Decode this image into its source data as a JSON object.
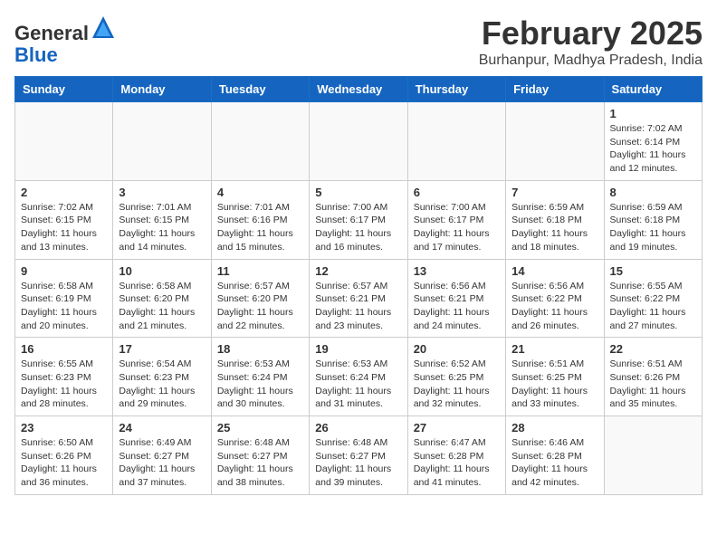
{
  "logo": {
    "general": "General",
    "blue": "Blue"
  },
  "title": {
    "month": "February 2025",
    "location": "Burhanpur, Madhya Pradesh, India"
  },
  "weekdays": [
    "Sunday",
    "Monday",
    "Tuesday",
    "Wednesday",
    "Thursday",
    "Friday",
    "Saturday"
  ],
  "weeks": [
    [
      {
        "day": "",
        "info": ""
      },
      {
        "day": "",
        "info": ""
      },
      {
        "day": "",
        "info": ""
      },
      {
        "day": "",
        "info": ""
      },
      {
        "day": "",
        "info": ""
      },
      {
        "day": "",
        "info": ""
      },
      {
        "day": "1",
        "info": "Sunrise: 7:02 AM\nSunset: 6:14 PM\nDaylight: 11 hours\nand 12 minutes."
      }
    ],
    [
      {
        "day": "2",
        "info": "Sunrise: 7:02 AM\nSunset: 6:15 PM\nDaylight: 11 hours\nand 13 minutes."
      },
      {
        "day": "3",
        "info": "Sunrise: 7:01 AM\nSunset: 6:15 PM\nDaylight: 11 hours\nand 14 minutes."
      },
      {
        "day": "4",
        "info": "Sunrise: 7:01 AM\nSunset: 6:16 PM\nDaylight: 11 hours\nand 15 minutes."
      },
      {
        "day": "5",
        "info": "Sunrise: 7:00 AM\nSunset: 6:17 PM\nDaylight: 11 hours\nand 16 minutes."
      },
      {
        "day": "6",
        "info": "Sunrise: 7:00 AM\nSunset: 6:17 PM\nDaylight: 11 hours\nand 17 minutes."
      },
      {
        "day": "7",
        "info": "Sunrise: 6:59 AM\nSunset: 6:18 PM\nDaylight: 11 hours\nand 18 minutes."
      },
      {
        "day": "8",
        "info": "Sunrise: 6:59 AM\nSunset: 6:18 PM\nDaylight: 11 hours\nand 19 minutes."
      }
    ],
    [
      {
        "day": "9",
        "info": "Sunrise: 6:58 AM\nSunset: 6:19 PM\nDaylight: 11 hours\nand 20 minutes."
      },
      {
        "day": "10",
        "info": "Sunrise: 6:58 AM\nSunset: 6:20 PM\nDaylight: 11 hours\nand 21 minutes."
      },
      {
        "day": "11",
        "info": "Sunrise: 6:57 AM\nSunset: 6:20 PM\nDaylight: 11 hours\nand 22 minutes."
      },
      {
        "day": "12",
        "info": "Sunrise: 6:57 AM\nSunset: 6:21 PM\nDaylight: 11 hours\nand 23 minutes."
      },
      {
        "day": "13",
        "info": "Sunrise: 6:56 AM\nSunset: 6:21 PM\nDaylight: 11 hours\nand 24 minutes."
      },
      {
        "day": "14",
        "info": "Sunrise: 6:56 AM\nSunset: 6:22 PM\nDaylight: 11 hours\nand 26 minutes."
      },
      {
        "day": "15",
        "info": "Sunrise: 6:55 AM\nSunset: 6:22 PM\nDaylight: 11 hours\nand 27 minutes."
      }
    ],
    [
      {
        "day": "16",
        "info": "Sunrise: 6:55 AM\nSunset: 6:23 PM\nDaylight: 11 hours\nand 28 minutes."
      },
      {
        "day": "17",
        "info": "Sunrise: 6:54 AM\nSunset: 6:23 PM\nDaylight: 11 hours\nand 29 minutes."
      },
      {
        "day": "18",
        "info": "Sunrise: 6:53 AM\nSunset: 6:24 PM\nDaylight: 11 hours\nand 30 minutes."
      },
      {
        "day": "19",
        "info": "Sunrise: 6:53 AM\nSunset: 6:24 PM\nDaylight: 11 hours\nand 31 minutes."
      },
      {
        "day": "20",
        "info": "Sunrise: 6:52 AM\nSunset: 6:25 PM\nDaylight: 11 hours\nand 32 minutes."
      },
      {
        "day": "21",
        "info": "Sunrise: 6:51 AM\nSunset: 6:25 PM\nDaylight: 11 hours\nand 33 minutes."
      },
      {
        "day": "22",
        "info": "Sunrise: 6:51 AM\nSunset: 6:26 PM\nDaylight: 11 hours\nand 35 minutes."
      }
    ],
    [
      {
        "day": "23",
        "info": "Sunrise: 6:50 AM\nSunset: 6:26 PM\nDaylight: 11 hours\nand 36 minutes."
      },
      {
        "day": "24",
        "info": "Sunrise: 6:49 AM\nSunset: 6:27 PM\nDaylight: 11 hours\nand 37 minutes."
      },
      {
        "day": "25",
        "info": "Sunrise: 6:48 AM\nSunset: 6:27 PM\nDaylight: 11 hours\nand 38 minutes."
      },
      {
        "day": "26",
        "info": "Sunrise: 6:48 AM\nSunset: 6:27 PM\nDaylight: 11 hours\nand 39 minutes."
      },
      {
        "day": "27",
        "info": "Sunrise: 6:47 AM\nSunset: 6:28 PM\nDaylight: 11 hours\nand 41 minutes."
      },
      {
        "day": "28",
        "info": "Sunrise: 6:46 AM\nSunset: 6:28 PM\nDaylight: 11 hours\nand 42 minutes."
      },
      {
        "day": "",
        "info": ""
      }
    ]
  ]
}
